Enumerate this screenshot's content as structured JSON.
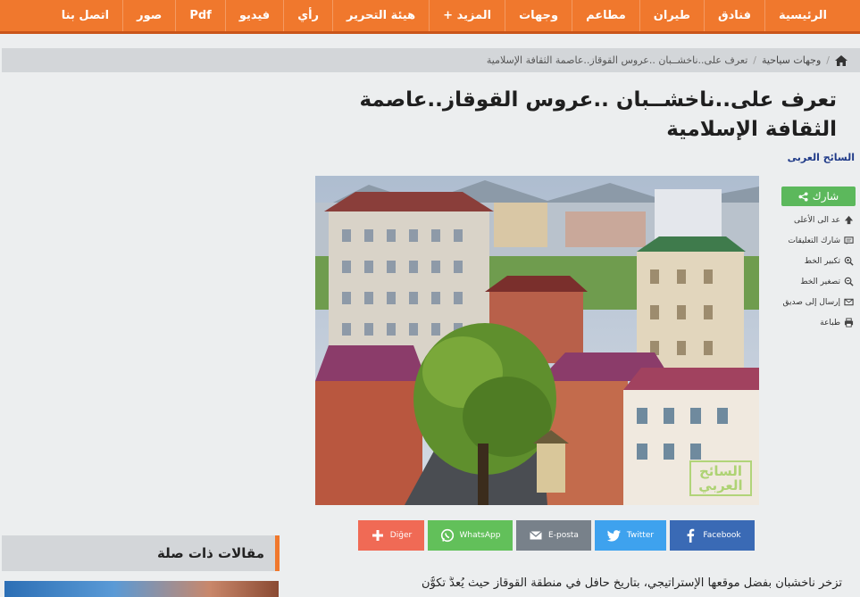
{
  "nav": {
    "items": [
      "الرئيسية",
      "فنادق",
      "طيران",
      "مطاعم",
      "وجهات",
      "+ المزيد",
      "هيئة التحرير",
      "رأي",
      "فيديو",
      "Pdf",
      "صور",
      "اتصل بنا"
    ]
  },
  "breadcrumb": {
    "section": "وجهات سياحية",
    "separator": "/",
    "current": "تعرف على..ناخشــبان ..عروس القوقاز..عاصمة الثقافة الإسلامية"
  },
  "article": {
    "title": "تعرف على..ناخشــبان ..عروس القوقاز..عاصمة الثقافة الإسلامية",
    "author": "السائح العربى",
    "lead": "تزخر ناخشبان بفضل موقعها الإستراتيجي، بتاريخ حافل في منطقة القوقاز حيث يُعدُّ تكوُّن"
  },
  "tools": {
    "share": "شارك",
    "items": [
      {
        "label": "عد الى الأعلى",
        "icon": "up-icon"
      },
      {
        "label": "شارك التعليقات",
        "icon": "comment-icon"
      },
      {
        "label": "تكبير الخط",
        "icon": "zoom-in-icon"
      },
      {
        "label": "تصغير الخط",
        "icon": "zoom-out-icon"
      },
      {
        "label": "إرسال إلى صديق",
        "icon": "mail-icon"
      },
      {
        "label": "طباعة",
        "icon": "print-icon"
      }
    ]
  },
  "social": {
    "diger": "Diğer",
    "whatsapp": "WhatsApp",
    "eposta": "E-posta",
    "twitter": "Twitter",
    "facebook": "Facebook"
  },
  "watermark": "السائح العربي",
  "related": {
    "title": "مقالات ذات صلة"
  },
  "colors": {
    "brand": "#f0782d",
    "share": "#5cb85c",
    "author": "#1f3a88"
  }
}
